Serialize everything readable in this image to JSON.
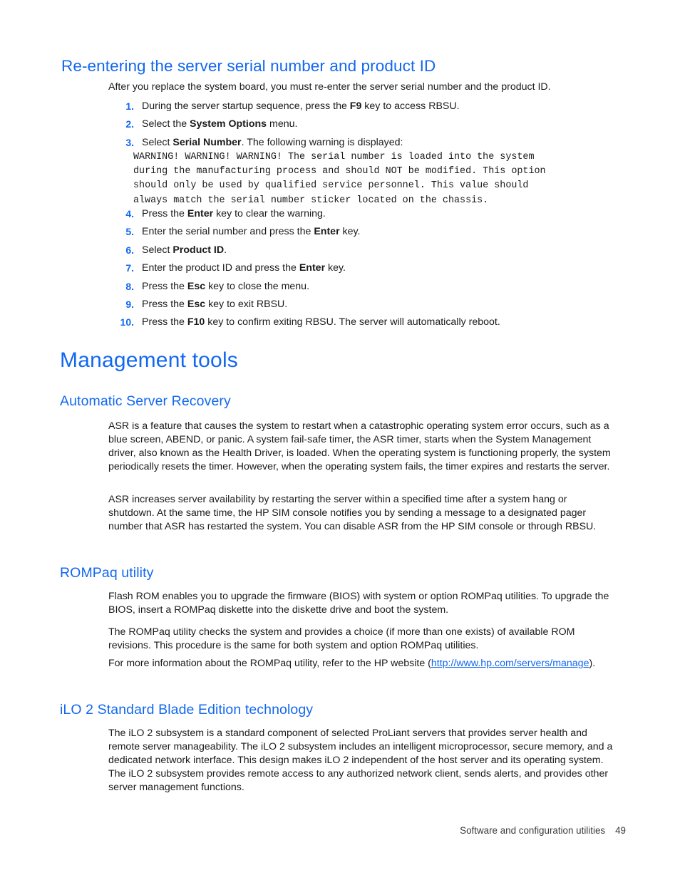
{
  "document": {
    "section_serial": {
      "heading": "Re-entering the server serial number and product ID",
      "intro": "After you replace the system board, you must re-enter the server serial number and the product ID.",
      "steps_before_warning": [
        {
          "num": "1.",
          "pre": "During the server startup sequence, press the ",
          "bold": "F9",
          "post": " key to access RBSU."
        },
        {
          "num": "2.",
          "pre": "Select the ",
          "bold": "System Options",
          "post": " menu."
        },
        {
          "num": "3.",
          "pre": "Select ",
          "bold": "Serial Number",
          "post": ". The following warning is displayed:"
        }
      ],
      "warning_text": "WARNING! WARNING! WARNING! The serial number is loaded into the system\nduring the manufacturing process and should NOT be modified. This option\nshould only be used by qualified service personnel. This value should\nalways match the serial number sticker located on the chassis.",
      "steps_after_warning": [
        {
          "num": "4.",
          "pre": "Press the ",
          "bold": "Enter",
          "post": " key to clear the warning."
        },
        {
          "num": "5.",
          "pre": "Enter the serial number and press the ",
          "bold": "Enter",
          "post": " key."
        },
        {
          "num": "6.",
          "pre": "Select ",
          "bold": "Product ID",
          "post": "."
        },
        {
          "num": "7.",
          "pre": "Enter the product ID and press the ",
          "bold": "Enter",
          "post": " key."
        },
        {
          "num": "8.",
          "pre": "Press the ",
          "bold": "Esc",
          "post": " key to close the menu."
        },
        {
          "num": "9.",
          "pre": "Press the ",
          "bold": "Esc",
          "post": " key to exit RBSU."
        },
        {
          "num": "10.",
          "pre": "Press the ",
          "bold": "F10",
          "post": " key to confirm exiting RBSU. The server will automatically reboot."
        }
      ]
    },
    "management_tools": {
      "heading": "Management tools",
      "asr": {
        "heading": "Automatic Server Recovery",
        "paragraph_1": "ASR is a feature that causes the system to restart when a catastrophic operating system error occurs, such as a blue screen, ABEND, or panic. A system fail-safe timer, the ASR timer, starts when the System Management driver, also known as the Health Driver, is loaded. When the operating system is functioning properly, the system periodically resets the timer. However, when the operating system fails, the timer expires and restarts the server.",
        "paragraph_2": "ASR increases server availability by restarting the server within a specified time after a system hang or shutdown. At the same time, the HP SIM console notifies you by sending a message to a designated pager number that ASR has restarted the system. You can disable ASR from the HP SIM console or through RBSU."
      },
      "rompaq": {
        "heading": "ROMPaq utility",
        "paragraph_1": "Flash ROM enables you to upgrade the firmware (BIOS) with system or option ROMPaq utilities. To upgrade the BIOS, insert a ROMPaq diskette into the diskette drive and boot the system.",
        "paragraph_2": "The ROMPaq utility checks the system and provides a choice (if more than one exists) of available ROM revisions. This procedure is the same for both system and option ROMPaq utilities.",
        "paragraph_3_pre": "For more information about the ROMPaq utility, refer to the HP website (",
        "link_text": "http://www.hp.com/servers/manage",
        "paragraph_3_post": ")."
      },
      "ilo": {
        "heading": "iLO 2 Standard Blade Edition technology",
        "paragraph_1": "The iLO 2 subsystem is a standard component of selected ProLiant servers that provides server health and remote server manageability. The iLO 2 subsystem includes an intelligent microprocessor, secure memory, and a dedicated network interface. This design makes iLO 2 independent of the host server and its operating system. The iLO 2 subsystem provides remote access to any authorized network client, sends alerts, and provides other server management functions."
      }
    },
    "footer": {
      "chapter": "Software and configuration utilities",
      "page_number": "49"
    },
    "colors": {
      "heading_blue": "#1268f0",
      "link_blue": "#1268f0",
      "body_black": "#1a1a1a"
    }
  }
}
